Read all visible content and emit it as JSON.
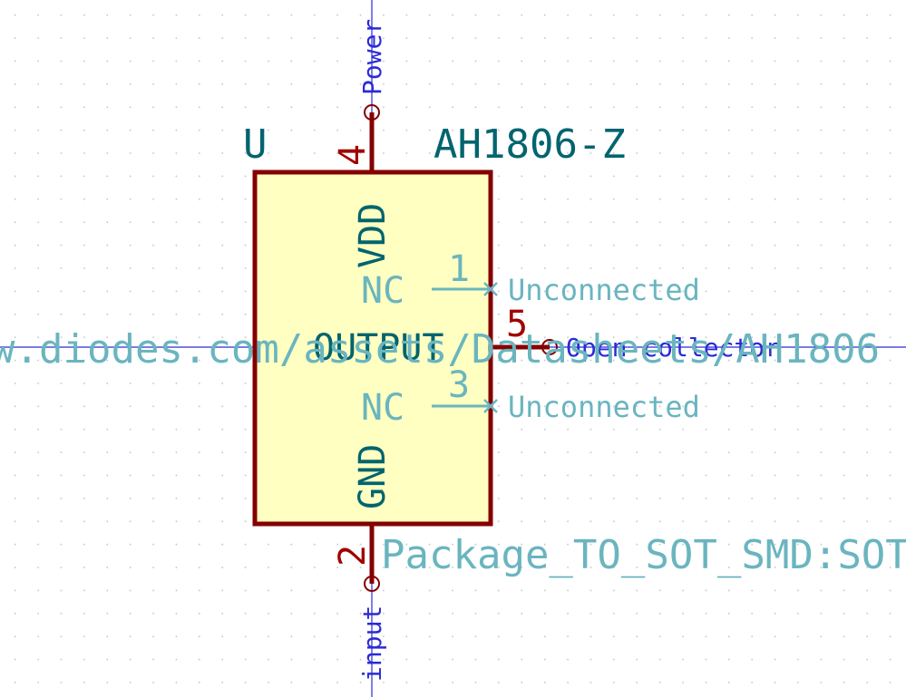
{
  "component": {
    "reference": "U",
    "value": "AH1806-Z",
    "footprint": "Package_TO_SOT_SMD:SOT",
    "datasheet": "w.diodes.com/assets/Datasheets/AH1806"
  },
  "pins": [
    {
      "number": "4",
      "name": "VDD",
      "type": "Power"
    },
    {
      "number": "1",
      "name": "NC",
      "type": "Unconnected"
    },
    {
      "number": "5",
      "name": "OUTPUT",
      "type": "Open collector"
    },
    {
      "number": "3",
      "name": "NC",
      "type": "Unconnected"
    },
    {
      "number": "2",
      "name": "GND",
      "type": "input"
    }
  ],
  "colors": {
    "body_fill": "#ffffc2",
    "body_outline": "#840000",
    "pin_line": "#840000",
    "pin_number": "#a00000",
    "pin_name": "#00646e",
    "field_text": "#00646e",
    "hidden_text": "#6ab5bf",
    "electrical_type": "#2b2bd6",
    "crosshair": "#2b2bd6"
  }
}
